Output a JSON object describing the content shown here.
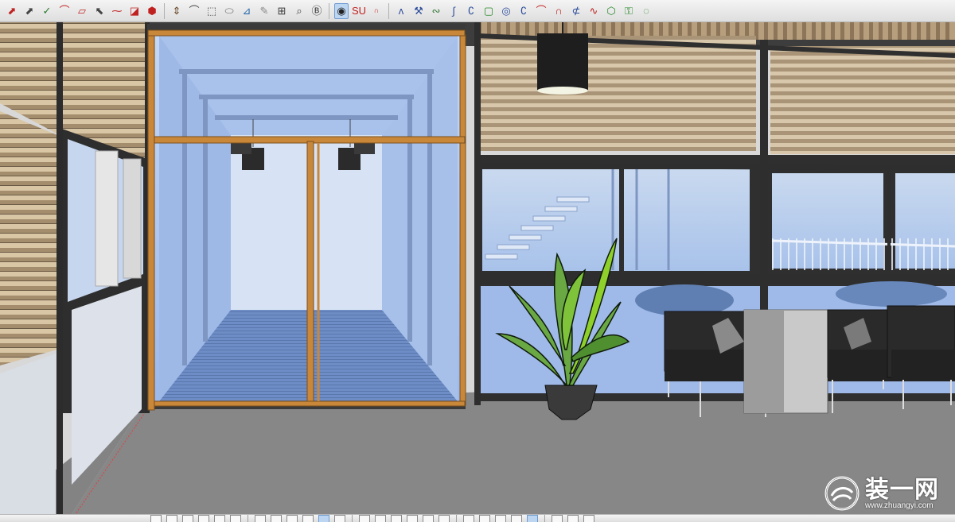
{
  "app": {
    "name": "SketchUp"
  },
  "toolbar_top": {
    "groups": [
      [
        "select-tool",
        "line-tool",
        "freehand-tool",
        "arc-tool",
        "rectangle-tool",
        "rotated-rectangle-tool",
        "circle-tool",
        "polygon-tool",
        "eraser-tool"
      ],
      [
        "paint-bucket-tool",
        "push-pull-tool",
        "follow-me-tool",
        "offset-tool",
        "move-tool",
        "rotate-tool",
        "scale-tool",
        "tape-measure-tool",
        "protractor-tool"
      ],
      [
        "text-tool",
        "sketchup-logo-tool",
        "su-plugin-tool"
      ],
      [
        "bezier-curve-tool",
        "polyline-tool",
        "spline-tool",
        "arc-curve-tool",
        "circle-curve-tool",
        "rectangle-curve-tool",
        "ellipse-tool",
        "arc-2-tool",
        "arc-3-tool",
        "arc-4-tool",
        "zigzag-tool",
        "polygon-curve-tool",
        "wrench-tool",
        "lasso-tool",
        "triangle-tool"
      ]
    ],
    "icons": [
      "⬈",
      "⬈",
      "✓",
      "⌒",
      "▱",
      "⬉",
      "⁓",
      "◪",
      "⬢",
      "⇕",
      "⌒",
      "⬚",
      "⬭",
      "⊿",
      "✎",
      "⊞",
      "⌕",
      "Ⓑ",
      "◉",
      "SU",
      "∩",
      "ᴧ",
      "⚒",
      "∾",
      "∫",
      "∁",
      "▢",
      "◎",
      "∁",
      "⌒",
      "∩",
      "⊄",
      "∿",
      "⬡",
      "⚿",
      "◌",
      "⊲"
    ],
    "active_index": 18
  },
  "toolbar_bottom": {
    "count": 26,
    "active_indices": [
      10,
      22
    ]
  },
  "watermark": {
    "title": "装一网",
    "url": "www.zhuangyi.com"
  },
  "colors": {
    "toolbar_bg": "#e8e8e8",
    "floor": "#8a8a8a",
    "glass": "#9dbcf0",
    "wood_frame": "#d08a3a",
    "dark_frame": "#3a3a3a",
    "slat": "#bfa98a",
    "sofa": "#2a2a2a",
    "plant": "#5aa83a"
  }
}
